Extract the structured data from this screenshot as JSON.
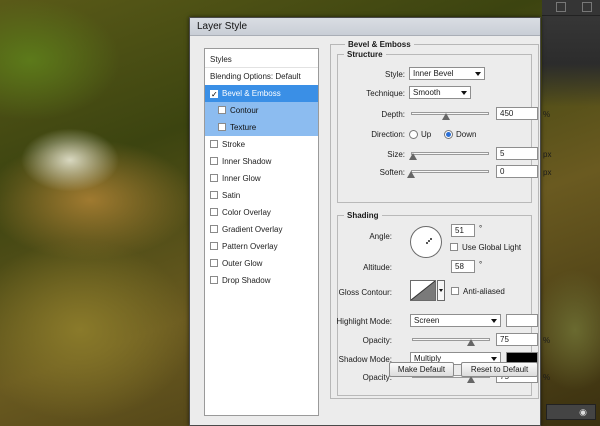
{
  "dialog": {
    "title": "Layer Style"
  },
  "styles_list": {
    "header": "Styles",
    "items": [
      {
        "label": "Blending Options: Default",
        "checkbox": false,
        "checked": false,
        "state": "normal"
      },
      {
        "label": "Bevel & Emboss",
        "checkbox": true,
        "checked": true,
        "state": "selected"
      },
      {
        "label": "Contour",
        "checkbox": true,
        "checked": false,
        "state": "sub"
      },
      {
        "label": "Texture",
        "checkbox": true,
        "checked": false,
        "state": "sub"
      },
      {
        "label": "Stroke",
        "checkbox": true,
        "checked": false,
        "state": "normal"
      },
      {
        "label": "Inner Shadow",
        "checkbox": true,
        "checked": false,
        "state": "normal"
      },
      {
        "label": "Inner Glow",
        "checkbox": true,
        "checked": false,
        "state": "normal"
      },
      {
        "label": "Satin",
        "checkbox": true,
        "checked": false,
        "state": "normal"
      },
      {
        "label": "Color Overlay",
        "checkbox": true,
        "checked": false,
        "state": "normal"
      },
      {
        "label": "Gradient Overlay",
        "checkbox": true,
        "checked": false,
        "state": "normal"
      },
      {
        "label": "Pattern Overlay",
        "checkbox": true,
        "checked": false,
        "state": "normal"
      },
      {
        "label": "Outer Glow",
        "checkbox": true,
        "checked": false,
        "state": "normal"
      },
      {
        "label": "Drop Shadow",
        "checkbox": true,
        "checked": false,
        "state": "normal"
      }
    ]
  },
  "bevel": {
    "title": "Bevel & Emboss",
    "structure": {
      "title": "Structure",
      "style_label": "Style:",
      "style_value": "Inner Bevel",
      "technique_label": "Technique:",
      "technique_value": "Smooth",
      "depth_label": "Depth:",
      "depth_value": "450",
      "depth_unit": "%",
      "depth_slider": 0.45,
      "direction_label": "Direction:",
      "dir_up": "Up",
      "dir_down": "Down",
      "direction_selected": "Down",
      "size_label": "Size:",
      "size_value": "5",
      "size_unit": "px",
      "size_slider": 0.03,
      "soften_label": "Soften:",
      "soften_value": "0",
      "soften_unit": "px",
      "soften_slider": 0.0
    },
    "shading": {
      "title": "Shading",
      "angle_label": "Angle:",
      "angle_value": "51",
      "angle_unit": "°",
      "use_global_light": "Use Global Light",
      "use_global_light_checked": false,
      "altitude_label": "Altitude:",
      "altitude_value": "58",
      "altitude_unit": "°",
      "gloss_label": "Gloss Contour:",
      "anti_aliased": "Anti-aliased",
      "anti_aliased_checked": false,
      "highlight_label": "Highlight Mode:",
      "highlight_value": "Screen",
      "highlight_color": "#ffffff",
      "hl_opacity_label": "Opacity:",
      "hl_opacity_value": "75",
      "hl_opacity_unit": "%",
      "hl_opacity_slider": 0.75,
      "shadow_label": "Shadow Mode:",
      "shadow_value": "Multiply",
      "shadow_color": "#000000",
      "sh_opacity_label": "Opacity:",
      "sh_opacity_value": "75",
      "sh_opacity_unit": "%",
      "sh_opacity_slider": 0.75
    },
    "make_default": "Make Default",
    "reset_default": "Reset to Default"
  }
}
